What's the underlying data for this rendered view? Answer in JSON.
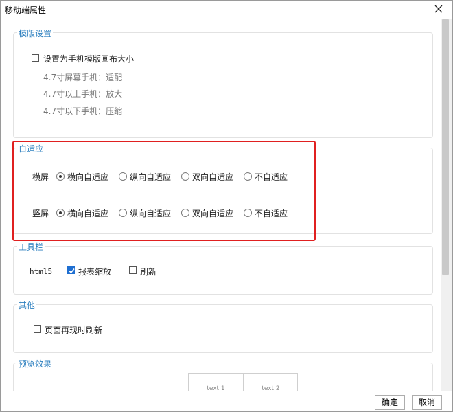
{
  "window": {
    "title": "移动端属性",
    "close_icon": "close-icon"
  },
  "template_group": {
    "title": "模版设置",
    "checkbox_label": "设置为手机模版画布大小",
    "checked": false,
    "hints": [
      "4.7寸屏幕手机：适配",
      "4.7寸以上手机：放大",
      "4.7寸以下手机：压缩"
    ]
  },
  "adaptive_group": {
    "title": "自适应",
    "rows": [
      {
        "label": "横屏",
        "options": [
          "横向自适应",
          "纵向自适应",
          "双向自适应",
          "不自适应"
        ],
        "selected": 0
      },
      {
        "label": "竖屏",
        "options": [
          "横向自适应",
          "纵向自适应",
          "双向自适应",
          "不自适应"
        ],
        "selected": 0
      }
    ],
    "highlight_color": "#e02020"
  },
  "toolbar_group": {
    "title": "工具栏",
    "prefix": "html5",
    "options": [
      {
        "label": "报表缩放",
        "checked": true
      },
      {
        "label": "刷新",
        "checked": false
      }
    ]
  },
  "other_group": {
    "title": "其他",
    "checkbox_label": "页面再现时刷新",
    "checked": false
  },
  "preview_group": {
    "title": "预览效果",
    "cells": [
      "text 1",
      "text 2"
    ]
  },
  "buttons": {
    "ok": "确定",
    "cancel": "取消"
  },
  "colors": {
    "accent": "#2c7fbf",
    "check": "#1f6fd1"
  }
}
